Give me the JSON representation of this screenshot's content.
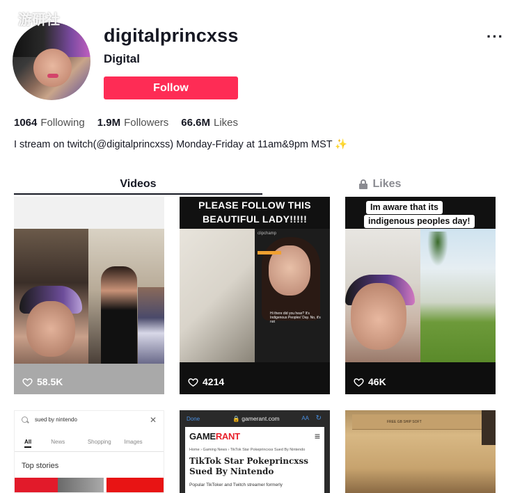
{
  "watermark": "游研社",
  "profile": {
    "username": "digitalprincxss",
    "nickname": "Digital",
    "follow_label": "Follow",
    "more_label": "···",
    "bio": "I stream on twitch(@digitalprincxss) Monday-Friday at 11am&9pm MST ✨"
  },
  "stats": {
    "following_count": "1064",
    "following_label": "Following",
    "followers_count": "1.9M",
    "followers_label": "Followers",
    "likes_count": "66.6M",
    "likes_label": "Likes"
  },
  "tabs": {
    "videos_label": "Videos",
    "likes_label": "Likes"
  },
  "videos": [
    {
      "likes": "58.5K"
    },
    {
      "likes": "4214",
      "caption_line1": "PLEASE FOLLOW THIS",
      "caption_line2": "BEAUTIFUL LADY!!!!!",
      "overlay_text": "Hi there did you hear? It's Indigenous Peoples' Day. No, it's not",
      "watermark": "clipchamp"
    },
    {
      "likes": "46K",
      "bubble_line1": "Im aware that its",
      "bubble_line2": "indigenous peoples day!"
    },
    {
      "search_query": "sued by nintendo",
      "filters": [
        "All",
        "News",
        "Shopping",
        "Images"
      ],
      "section": "Top stories"
    },
    {
      "done_label": "Done",
      "url": "gamerant.com",
      "aa_label": "AA",
      "logo_game": "GAME",
      "logo_rant": "RANT",
      "crumbs": "Home › Gaming News › TikTok Star Pokeprincxss Sued By Nintendo",
      "headline": "TikTok Star Pokeprincxss Sued By Nintendo",
      "subtext": "Popular TikToker and Twitch streamer formerly"
    },
    {
      "box_text": "FREE GB SHIP SOFT"
    }
  ],
  "colors": {
    "follow_button": "#fe2c55",
    "text_primary": "#161823",
    "text_secondary": "#8a8b91"
  }
}
